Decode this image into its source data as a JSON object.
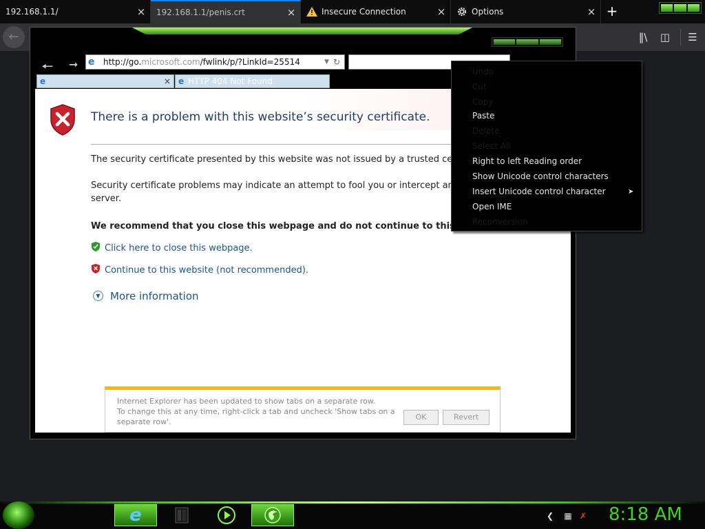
{
  "firefox": {
    "tabs": [
      {
        "title": "192.168.1.1/"
      },
      {
        "title": "192.168.1.1/penis.crt"
      },
      {
        "title": "Insecure Connection"
      },
      {
        "title": "Options"
      }
    ],
    "close_glyph": "×",
    "new_tab_glyph": "+"
  },
  "ie": {
    "address": {
      "prefix": "http://go.",
      "dim": "microsoft.com",
      "rest": "/fwlink/p/?LinkId=25514"
    },
    "tabs": [
      {
        "title": "HTTP 404 Not Found"
      }
    ],
    "error": {
      "title": "There is a problem with this website’s security certificate.",
      "para1": "The security certificate presented by this website was not issued by a trusted certif",
      "para2_line1": "Security certificate problems may indicate an attempt to fool you or intercept any d",
      "para2_line2": "server.",
      "recommend": "We recommend that you close this webpage and do not continue to this webs",
      "close_link": "Click here to close this webpage.",
      "continue_link": "Continue to this website (not recommended).",
      "more_info": "More information"
    },
    "info_bar": {
      "line1": "Internet Explorer has been updated to show tabs on a separate row.",
      "line2": "To change this at any time, right-click a tab and uncheck 'Show tabs on a",
      "line3": "separate row'.",
      "ok": "OK",
      "revert": "Revert"
    }
  },
  "context_menu": {
    "items": [
      {
        "label": "Undo",
        "enabled": false
      },
      {
        "label": "Cut",
        "enabled": false
      },
      {
        "label": "Copy",
        "enabled": false
      },
      {
        "label": "Paste",
        "enabled": true
      },
      {
        "label": "Delete",
        "enabled": false
      },
      {
        "label": "Select All",
        "enabled": false
      },
      {
        "label": "Right to left Reading order",
        "enabled": true
      },
      {
        "label": "Show Unicode control characters",
        "enabled": true
      },
      {
        "label": "Insert Unicode control character",
        "enabled": true
      },
      {
        "label": "Open IME",
        "enabled": true
      },
      {
        "label": "Reconversion",
        "enabled": false
      }
    ]
  },
  "taskbar": {
    "clock": "8:18 AM"
  },
  "colors": {
    "accent_green": "#3cd41c",
    "ie_link": "#1c5490",
    "firefox_active": "#0a84ff"
  }
}
